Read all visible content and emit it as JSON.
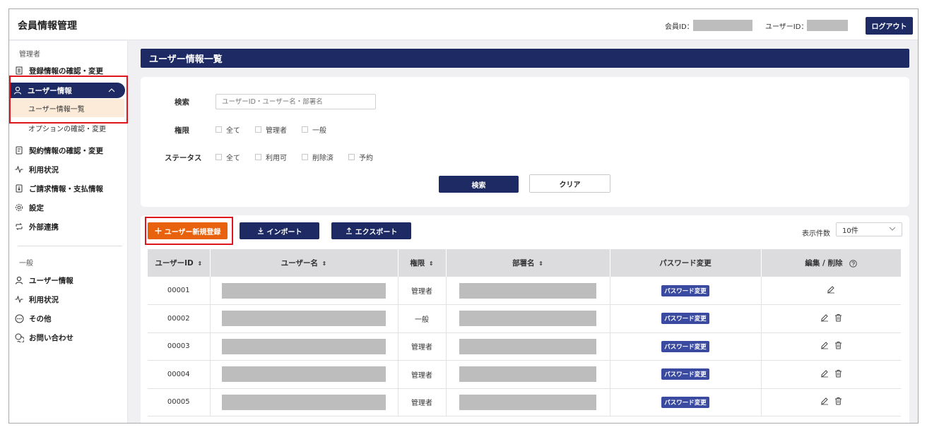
{
  "header": {
    "app_title": "会員情報管理",
    "member_id_label": "会員ID：",
    "user_id_label": "ユーザーID：",
    "logout_label": "ログアウト"
  },
  "sidebar": {
    "admin_section": "管理者",
    "admin_items": [
      {
        "label": "登録情報の確認・変更",
        "icon": "building-icon"
      },
      {
        "label": "ユーザー情報",
        "icon": "user-icon"
      },
      {
        "label": "ユーザー情報一覧"
      },
      {
        "label": "オプションの確認・変更"
      },
      {
        "label": "契約情報の確認・変更",
        "icon": "document-icon"
      },
      {
        "label": "利用状況",
        "icon": "activity-icon"
      },
      {
        "label": "ご請求情報・支払情報",
        "icon": "invoice-icon"
      },
      {
        "label": "設定",
        "icon": "gear-icon"
      },
      {
        "label": "外部連携",
        "icon": "link-icon"
      }
    ],
    "general_section": "一般",
    "general_items": [
      {
        "label": "ユーザー情報",
        "icon": "user-icon"
      },
      {
        "label": "利用状況",
        "icon": "activity-icon"
      },
      {
        "label": "その他",
        "icon": "more-icon"
      },
      {
        "label": "お問い合わせ",
        "icon": "chat-icon"
      }
    ]
  },
  "page_title": "ユーザー情報一覧",
  "search": {
    "search_label": "検索",
    "placeholder": "ユーザーID・ユーザー名・部署名",
    "role_label": "権限",
    "role_options": [
      "全て",
      "管理者",
      "一般"
    ],
    "status_label": "ステータス",
    "status_options": [
      "全て",
      "利用可",
      "削除済",
      "予約"
    ],
    "search_button": "検索",
    "clear_button": "クリア"
  },
  "toolbar": {
    "new_user": "ユーザー新規登録",
    "import": "インポート",
    "export": "エクスポート",
    "display_count_label": "表示件数",
    "display_count_value": "10件"
  },
  "table": {
    "columns": [
      "ユーザーID",
      "ユーザー名",
      "権限",
      "部署名",
      "パスワード変更",
      "編集 / 削除"
    ],
    "sort_icon": "⇕",
    "rows": [
      {
        "id": "00001",
        "role": "管理者",
        "pw": "パスワード変更",
        "deletable": false
      },
      {
        "id": "00002",
        "role": "一般",
        "pw": "パスワード変更",
        "deletable": true
      },
      {
        "id": "00003",
        "role": "管理者",
        "pw": "パスワード変更",
        "deletable": true
      },
      {
        "id": "00004",
        "role": "管理者",
        "pw": "パスワード変更",
        "deletable": true
      },
      {
        "id": "00005",
        "role": "管理者",
        "pw": "パスワード変更",
        "deletable": true
      }
    ]
  },
  "colors": {
    "navy": "#1d2a63",
    "orange": "#e8620e",
    "highlight": "#e0141e",
    "active_sub_bg": "#fdebd9"
  }
}
